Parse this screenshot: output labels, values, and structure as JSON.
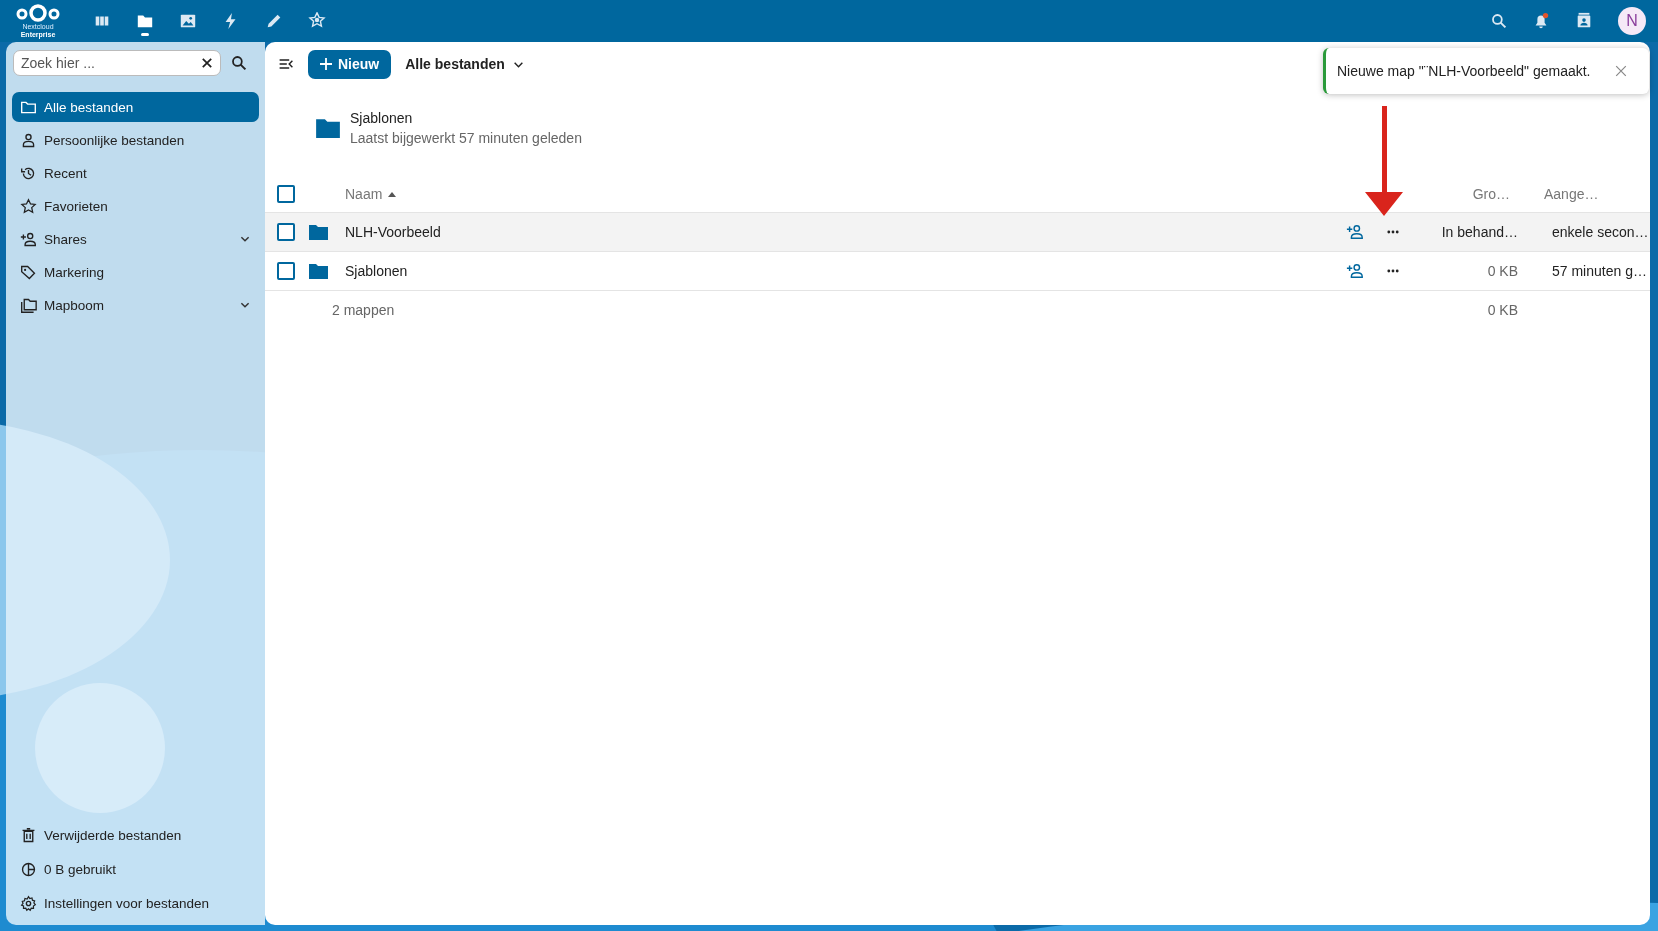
{
  "header": {
    "logo_line1": "Nextcloud",
    "logo_line2": "Enterprise",
    "apps": [
      {
        "kind": "dashboard",
        "selected": false
      },
      {
        "kind": "files",
        "selected": true
      },
      {
        "kind": "photos",
        "selected": false
      },
      {
        "kind": "activity",
        "selected": false
      },
      {
        "kind": "notes",
        "selected": false
      },
      {
        "kind": "star",
        "selected": false
      }
    ],
    "avatar": "N"
  },
  "sidebar": {
    "search": {
      "placeholder": "Zoek hier ..."
    },
    "items": [
      {
        "label": "Alle bestanden",
        "kind": "folder",
        "selected": true,
        "expandable": false
      },
      {
        "label": "Persoonlijke bestanden",
        "kind": "person",
        "selected": false,
        "expandable": false
      },
      {
        "label": "Recent",
        "kind": "history",
        "selected": false,
        "expandable": false
      },
      {
        "label": "Favorieten",
        "kind": "star",
        "selected": false,
        "expandable": false
      },
      {
        "label": "Shares",
        "kind": "share",
        "selected": false,
        "expandable": true
      },
      {
        "label": "Markering",
        "kind": "tag",
        "selected": false,
        "expandable": false
      },
      {
        "label": "Mapboom",
        "kind": "folders",
        "selected": false,
        "expandable": true
      }
    ],
    "footer": [
      {
        "label": "Verwijderde bestanden",
        "kind": "trash"
      },
      {
        "label": "0 B gebruikt",
        "kind": "quota"
      },
      {
        "label": "Instellingen voor bestanden",
        "kind": "gear"
      }
    ]
  },
  "toolbar": {
    "new_button": "Nieuw",
    "breadcrumb": "Alle bestanden"
  },
  "recommended": {
    "name": "Sjablonen",
    "subtitle": "Laatst bijgewerkt 57 minuten geleden"
  },
  "table": {
    "select_all": {
      "selected": false
    },
    "columns": {
      "name": "Naam",
      "size": "Gro…",
      "modified": "Aange…"
    },
    "rows": [
      {
        "name": "NLH-Voorbeeld",
        "size": "In behand…",
        "modified": "enkele secon…",
        "selected": false,
        "highlighted": true
      },
      {
        "name": "Sjablonen",
        "size": "0 KB",
        "modified": "57 minuten g…",
        "selected": false,
        "highlighted": false
      }
    ],
    "summary": {
      "count": "2 mappen",
      "size": "0 KB"
    }
  },
  "toast": {
    "text": "Nieuwe map \"¨NLH-Voorbeeld\" gemaakt."
  }
}
